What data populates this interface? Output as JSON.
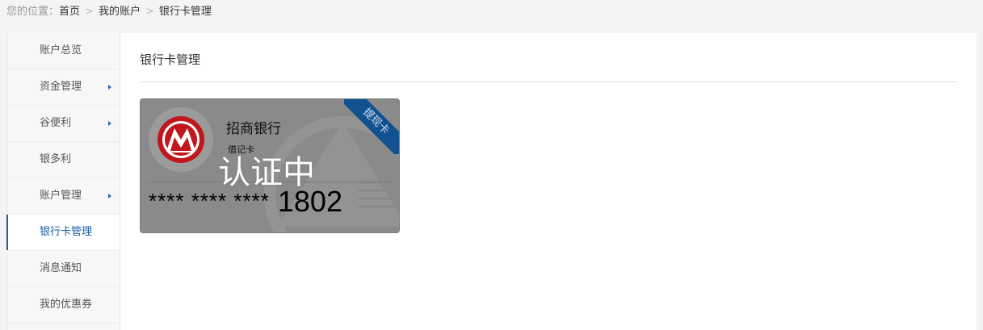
{
  "breadcrumb": {
    "prefix": "您的位置：",
    "items": [
      "首页",
      "我的账户",
      "银行卡管理"
    ],
    "separator": ">"
  },
  "sidebar": {
    "items": [
      {
        "label": "账户总览",
        "has_submenu": false,
        "active": false
      },
      {
        "label": "资金管理",
        "has_submenu": true,
        "active": false
      },
      {
        "label": "谷便利",
        "has_submenu": true,
        "active": false
      },
      {
        "label": "银多利",
        "has_submenu": false,
        "active": false
      },
      {
        "label": "账户管理",
        "has_submenu": true,
        "active": false
      },
      {
        "label": "银行卡管理",
        "has_submenu": false,
        "active": true
      },
      {
        "label": "消息通知",
        "has_submenu": false,
        "active": false
      },
      {
        "label": "我的优惠券",
        "has_submenu": false,
        "active": false
      }
    ]
  },
  "main": {
    "title": "银行卡管理"
  },
  "card": {
    "bank_name": "招商银行",
    "card_type": "借记卡",
    "masked_number": "**** **** ****",
    "last_digits": "1802",
    "status": "认证中",
    "ribbon_label": "提现卡",
    "logo_icon": "cmb-bank-logo-icon"
  },
  "colors": {
    "accent": "#1a5ea6",
    "card_bg": "#8a8a8a",
    "ribbon": "#11518f",
    "logo_red": "#c0161c"
  }
}
